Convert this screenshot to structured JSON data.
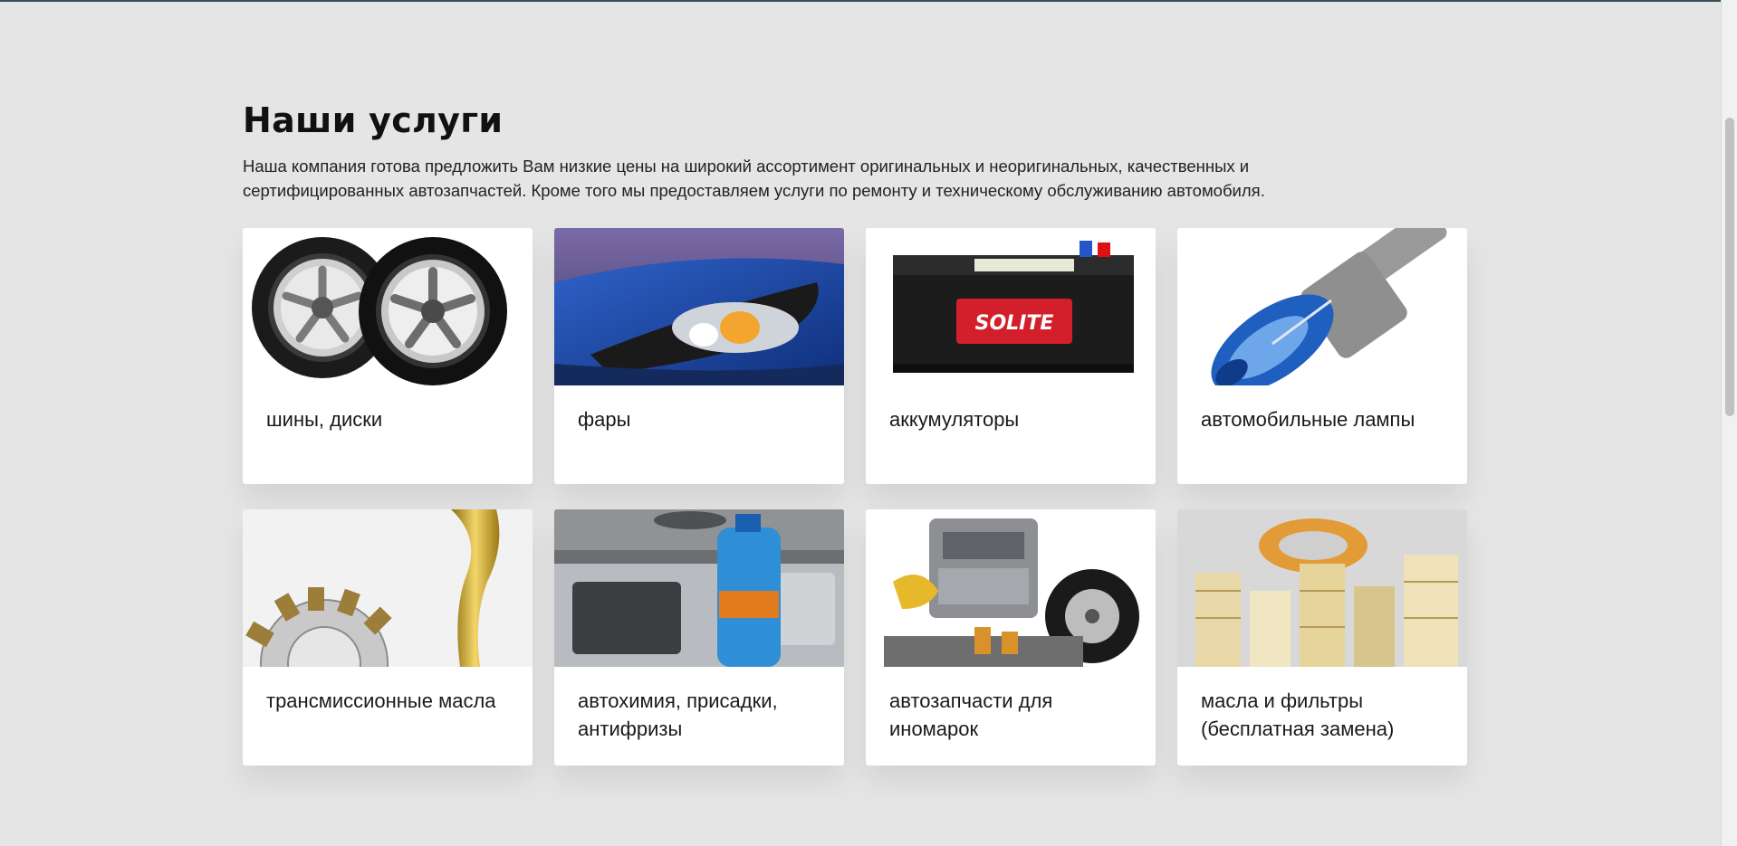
{
  "services": {
    "title": "Наши услуги",
    "description": "Наша компания готова предложить Вам низкие цены на широкий ассортимент оригинальных и неоригинальных, качественных и сертифицированных автозапчастей. Кроме того мы предоставляем услуги по ремонту и техническому обслуживанию автомобиля.",
    "cards": [
      {
        "label": "шины, диски",
        "icon": "tires-wheels-image"
      },
      {
        "label": "фары",
        "icon": "headlight-image"
      },
      {
        "label": "аккумуляторы",
        "icon": "car-battery-image"
      },
      {
        "label": "автомобильные лампы",
        "icon": "car-bulb-image"
      },
      {
        "label": "трансмиссионные масла",
        "icon": "gear-oil-image"
      },
      {
        "label": "автохимия, присадки, антифризы",
        "icon": "antifreeze-image"
      },
      {
        "label": "автозапчасти для иномарок",
        "icon": "car-parts-image"
      },
      {
        "label": "масла и фильтры (бесплатная замена)",
        "icon": "oil-filters-image"
      }
    ]
  },
  "battery_brand": "SOLITE"
}
